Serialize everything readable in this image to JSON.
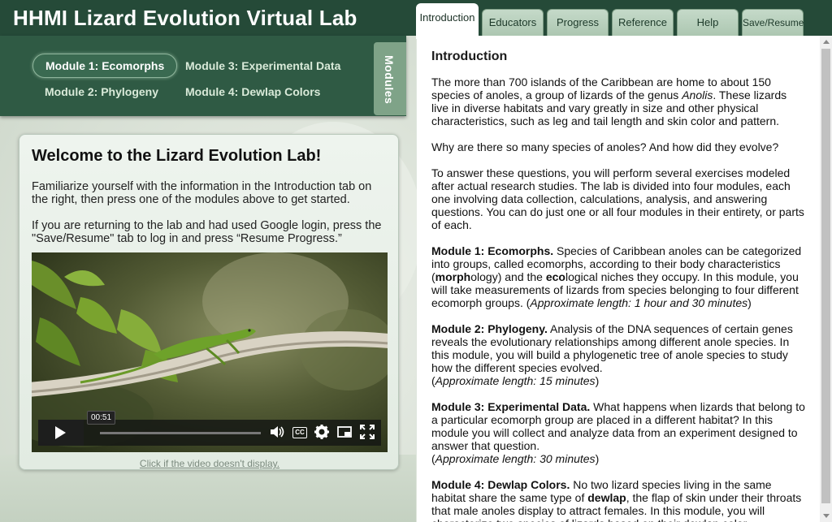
{
  "app": {
    "title": "HHMI Lizard Evolution Virtual Lab"
  },
  "tabs": [
    {
      "label": "Introduction",
      "active": true
    },
    {
      "label": "Educators"
    },
    {
      "label": "Progress"
    },
    {
      "label": "Reference"
    },
    {
      "label": "Help"
    },
    {
      "label": "Save/Resume"
    }
  ],
  "modules": {
    "tab_label": "Modules",
    "items": [
      {
        "label": "Module 1: Ecomorphs",
        "active": true
      },
      {
        "label": "Module 2: Phylogeny"
      },
      {
        "label": "Module 3: Experimental Data"
      },
      {
        "label": "Module 4: Dewlap Colors"
      }
    ]
  },
  "welcome": {
    "title": "Welcome to the Lizard Evolution Lab!",
    "para1": "Familiarize yourself with the information in the Introduction tab on the right, then press one of the modules above to get started.",
    "para2": "If you are returning to the lab and had used Google login, press the \"Save/Resume\" tab to log in and press “Resume Progress.”",
    "video_time": "00:51",
    "video_progress_fraction": 0.0,
    "video_link": "Click if the video doesn't display."
  },
  "intro": {
    "heading": "Introduction",
    "p1_before": "The more than 700 islands of the Caribbean are home to about 150 species of anoles, a group of lizards of the genus ",
    "p1_genus": "Anolis",
    "p1_after": ". These lizards live in diverse habitats and vary greatly in size and other physical characteristics, such as leg and tail length and skin color and pattern.",
    "p2": "Why are there so many species of anoles? And how did they evolve?",
    "p3": "To answer these questions, you will perform several exercises modeled after actual research studies. The lab is divided into four modules, each one involving data collection, calculations, analysis, and answering questions. You can do just one or all four modules in their entirety, or parts of each.",
    "m1_title": "Module 1: Ecomorphs.",
    "m1_text_a": " Species of Caribbean anoles can be categorized into groups, called ecomorphs, according to their body characteristics (",
    "m1_bold_morph": "morph",
    "m1_text_b": "ology) and the ",
    "m1_bold_eco": "eco",
    "m1_text_c": "logical niches they occupy. In this module, you will take measurements of lizards from species belonging to four different ecomorph groups. (",
    "m1_length": "Approximate length: 1 hour and 30 minutes",
    "m1_close": ")",
    "m2_title": "Module 2: Phylogeny.",
    "m2_text": " Analysis of the DNA sequences of certain genes reveals the evolutionary relationships among different anole species. In this module, you will build a phylogenetic tree of anole species to study how the different species evolved.",
    "m2_open": "(",
    "m2_length": "Approximate length: 15 minutes",
    "m2_close": ")",
    "m3_title": "Module 3: Experimental Data.",
    "m3_text": " What happens when lizards that belong to a particular ecomorph group are placed in a different habitat? In this module you will collect and analyze data from an experiment designed to answer that question.",
    "m3_open": "(",
    "m3_length": "Approximate length: 30 minutes",
    "m3_close": ")",
    "m4_title": "Module 4: Dewlap Colors.",
    "m4_text_a": " No two lizard species living in the same habitat share the same type of ",
    "m4_bold": "dewlap",
    "m4_text_b": ", the flap of skin under their throats that male anoles display to attract females. In this module, you will characterize two species of lizards based on their dewlap color."
  }
}
